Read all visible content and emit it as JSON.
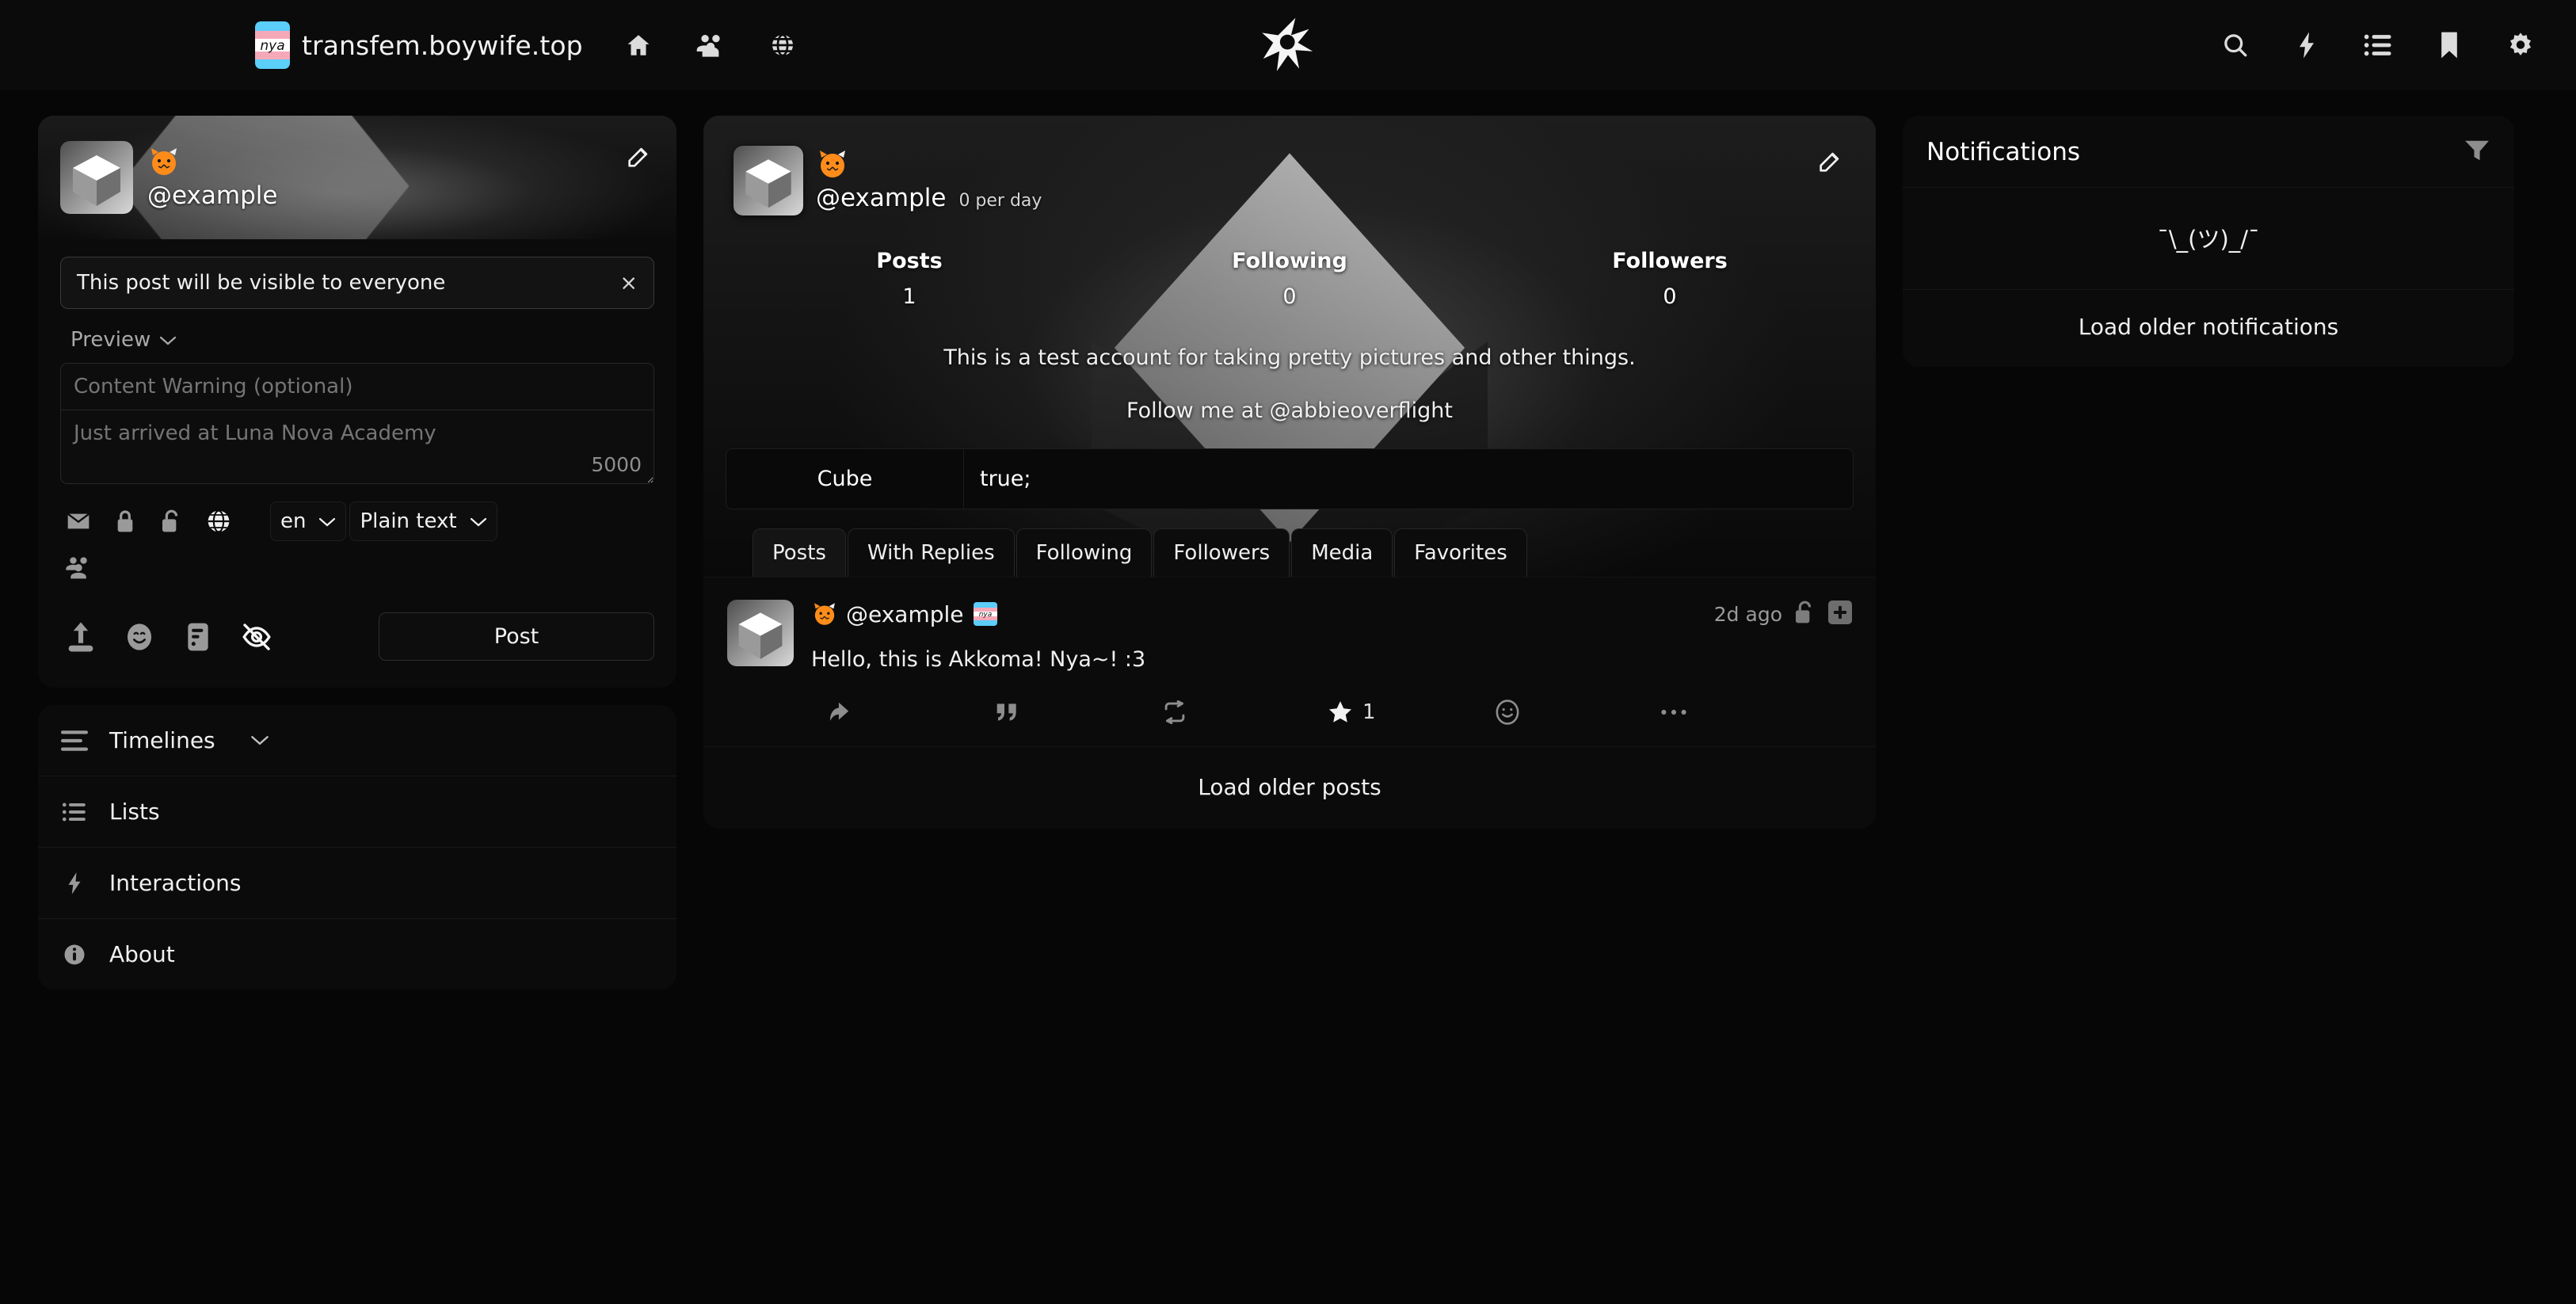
{
  "header": {
    "site_name": "transfem.boywife.top",
    "site_badge_icon": "nya-trans-flag-badge",
    "logo_icon": "akkoma-logo",
    "left_icons": [
      {
        "name": "home-icon",
        "label": "Home"
      },
      {
        "name": "local-timeline-people-icon",
        "label": "Local timeline"
      },
      {
        "name": "federated-timeline-globe-icon",
        "label": "Federated timeline"
      }
    ],
    "right_icons": [
      {
        "name": "search-icon",
        "label": "Search"
      },
      {
        "name": "interactions-bolt-icon",
        "label": "Interactions"
      },
      {
        "name": "lists-icon",
        "label": "Lists"
      },
      {
        "name": "bookmarks-icon",
        "label": "Bookmarks"
      },
      {
        "name": "settings-gear-icon",
        "label": "Settings"
      }
    ]
  },
  "user_card": {
    "handle": "@example",
    "emoji_name": "fox-cat-emoji",
    "edit_icon": "edit-profile-icon"
  },
  "composer": {
    "visibility_banner": "This post will be visible to everyone",
    "close_label": "×",
    "preview_label": "Preview",
    "cw_placeholder": "Content Warning (optional)",
    "body_placeholder": "Just arrived at Luna Nova Academy",
    "char_count": "5000",
    "visibility_icons": [
      {
        "name": "direct-message-envelope-icon",
        "label": "Direct"
      },
      {
        "name": "followers-only-lock-icon",
        "label": "Followers only"
      },
      {
        "name": "unlisted-unlock-icon",
        "label": "Unlisted"
      },
      {
        "name": "public-globe-icon",
        "label": "Public"
      },
      {
        "name": "local-only-people-icon",
        "label": "Local only"
      }
    ],
    "language_value": "en",
    "format_value": "Plain text",
    "tool_icons": [
      {
        "name": "attach-upload-icon",
        "label": "Attach media"
      },
      {
        "name": "emoji-picker-icon",
        "label": "Emoji"
      },
      {
        "name": "poll-icon",
        "label": "Poll"
      },
      {
        "name": "sensitive-eye-off-icon",
        "label": "Mark media sensitive"
      }
    ],
    "post_button": "Post"
  },
  "sidebar_nav": [
    {
      "label": "Timelines",
      "icon": "timelines-hamburger-icon",
      "caret": true
    },
    {
      "label": "Lists",
      "icon": "lists-icon",
      "caret": false
    },
    {
      "label": "Interactions",
      "icon": "interactions-bolt-icon",
      "caret": false
    },
    {
      "label": "About",
      "icon": "about-info-icon",
      "caret": false
    }
  ],
  "profile": {
    "handle": "@example",
    "emoji_name": "fox-cat-emoji",
    "per_day": "0 per day",
    "edit_icon": "edit-profile-icon",
    "stats": [
      {
        "label": "Posts",
        "value": "1"
      },
      {
        "label": "Following",
        "value": "0"
      },
      {
        "label": "Followers",
        "value": "0"
      }
    ],
    "bio_lines": [
      "This is a test account for taking pretty pictures and other things.",
      "Follow me at @abbieoverflight"
    ],
    "fields": [
      {
        "name": "Cube",
        "value": "true;"
      }
    ],
    "tabs": [
      {
        "label": "Posts",
        "active": true
      },
      {
        "label": "With Replies",
        "active": false
      },
      {
        "label": "Following",
        "active": false
      },
      {
        "label": "Followers",
        "active": false
      },
      {
        "label": "Media",
        "active": false
      },
      {
        "label": "Favorites",
        "active": false
      }
    ]
  },
  "post": {
    "handle": "@example",
    "emoji_name": "fox-cat-emoji",
    "flag_emoji_name": "nya-trans-flag-emoji",
    "timestamp": "2d ago",
    "visibility_icon": "unlisted-unlock-icon",
    "expand_icon": "expand-plus-icon",
    "body": "Hello, this is Akkoma! Nya~! :3",
    "actions": [
      {
        "name": "reply-icon",
        "count": ""
      },
      {
        "name": "quote-icon",
        "count": ""
      },
      {
        "name": "repeat-boost-icon",
        "count": ""
      },
      {
        "name": "favorite-star-icon",
        "count": "1"
      },
      {
        "name": "react-emoji-icon",
        "count": ""
      },
      {
        "name": "more-options-icon",
        "count": ""
      }
    ],
    "load_more": "Load older posts"
  },
  "notifications": {
    "title": "Notifications",
    "filter_icon": "filter-funnel-icon",
    "empty_text": "¯\\_(ツ)_/¯",
    "load_older": "Load older notifications"
  }
}
